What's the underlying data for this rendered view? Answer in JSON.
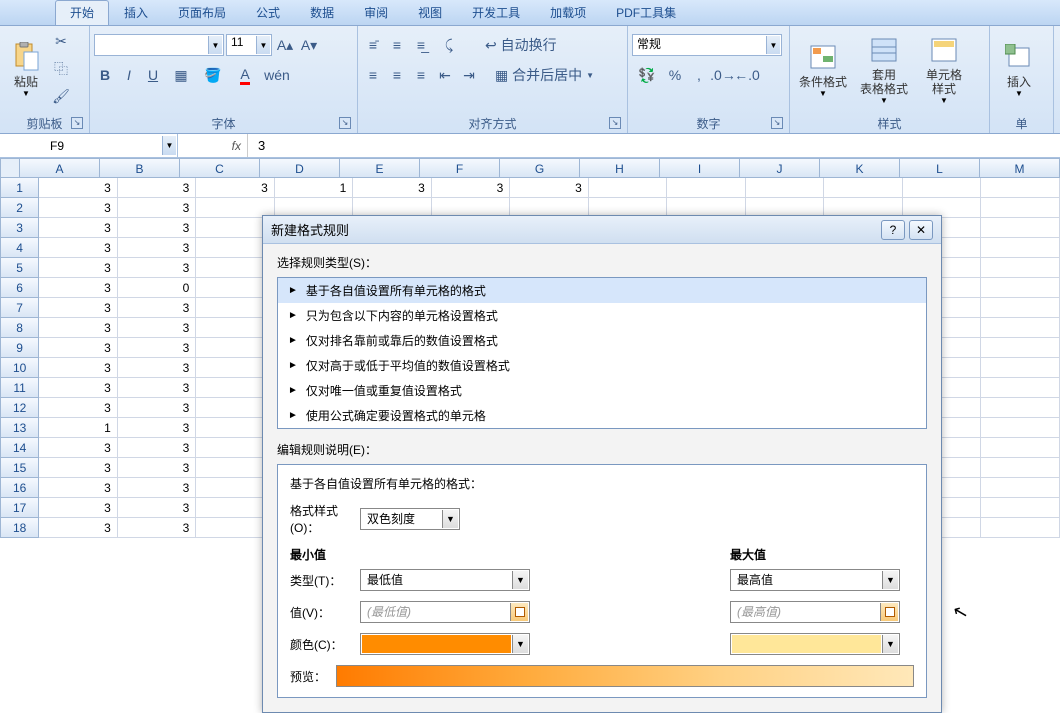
{
  "tabs": {
    "start": "开始",
    "insert": "插入",
    "layout": "页面布局",
    "formula": "公式",
    "data": "数据",
    "review": "审阅",
    "view": "视图",
    "dev": "开发工具",
    "addin": "加载项",
    "pdf": "PDF工具集"
  },
  "groups": {
    "clipboard": "剪贴板",
    "font": "字体",
    "align": "对齐方式",
    "number": "数字",
    "styles": "样式",
    "insert_btn": "插",
    "cells": "单"
  },
  "ribbon": {
    "paste": "粘贴",
    "font_size": "11",
    "wrap": "自动换行",
    "merge": "合并后居中",
    "numfmt": "常规",
    "cond": "条件格式",
    "tablefmt": "套用\n表格格式",
    "cellstyle": "单元格\n样式",
    "insert": "插入"
  },
  "namebox": "F9",
  "formula": "3",
  "cols": [
    "A",
    "B",
    "C",
    "D",
    "E",
    "F",
    "G",
    "H",
    "I",
    "J",
    "K",
    "L",
    "M"
  ],
  "sheet": [
    [
      3,
      3,
      3,
      1,
      3,
      3,
      3
    ],
    [
      3,
      3
    ],
    [
      3,
      3
    ],
    [
      3,
      3
    ],
    [
      3,
      3
    ],
    [
      3,
      0
    ],
    [
      3,
      3
    ],
    [
      3,
      3
    ],
    [
      3,
      3
    ],
    [
      3,
      3
    ],
    [
      3,
      3
    ],
    [
      3,
      3
    ],
    [
      1,
      3
    ],
    [
      3,
      3
    ],
    [
      3,
      3
    ],
    [
      3,
      3
    ],
    [
      3,
      3
    ],
    [
      3,
      3
    ]
  ],
  "dialog": {
    "title": "新建格式规则",
    "select_label": "选择规则类型(S)：",
    "rules": [
      "基于各自值设置所有单元格的格式",
      "只为包含以下内容的单元格设置格式",
      "仅对排名靠前或靠后的数值设置格式",
      "仅对高于或低于平均值的数值设置格式",
      "仅对唯一值或重复值设置格式",
      "使用公式确定要设置格式的单元格"
    ],
    "edit_label": "编辑规则说明(E)：",
    "edit_title": "基于各自值设置所有单元格的格式：",
    "style_label": "格式样式(O)：",
    "style_value": "双色刻度",
    "min_header": "最小值",
    "max_header": "最大值",
    "type_label": "类型(T)：",
    "type_min": "最低值",
    "type_max": "最高值",
    "value_label": "值(V)：",
    "value_min": "(最低值)",
    "value_max": "(最高值)",
    "color_label": "颜色(C)：",
    "preview_label": "预览："
  },
  "chart_data": null
}
